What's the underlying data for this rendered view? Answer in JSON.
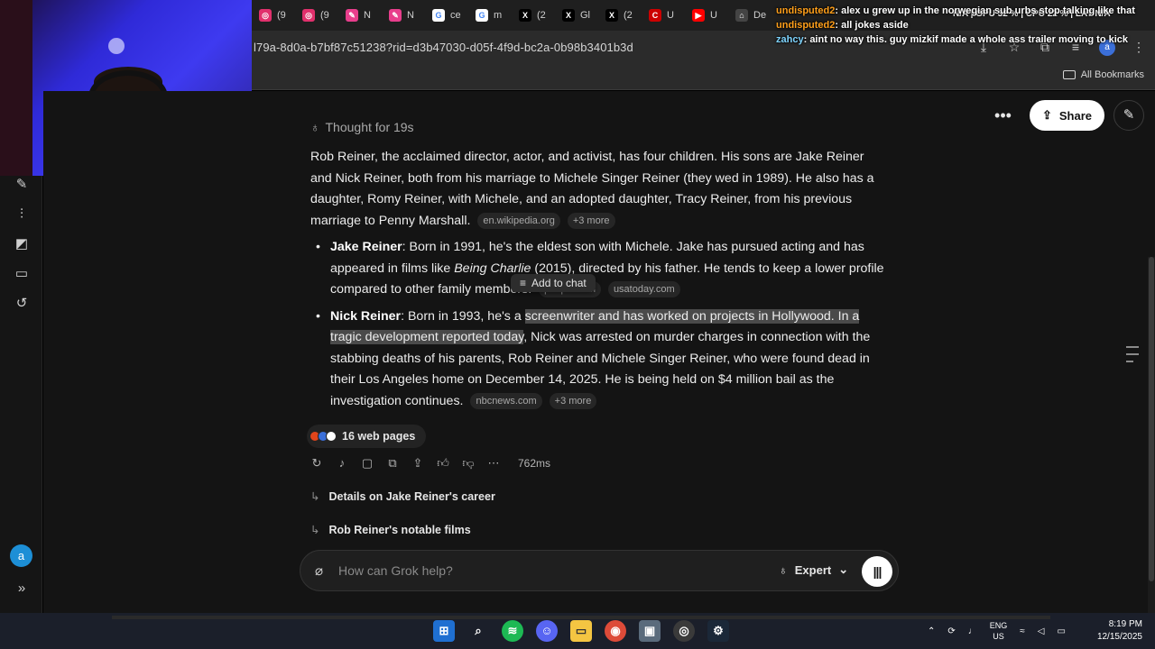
{
  "tabs": [
    {
      "label": "(9",
      "icon": "instagram-icon",
      "color": "#e1306c",
      "glyph": "◎"
    },
    {
      "label": "(9",
      "icon": "instagram-icon",
      "color": "#e1306c",
      "glyph": "◎"
    },
    {
      "label": "N",
      "icon": "pen-icon",
      "color": "#e83e8c",
      "glyph": "✎"
    },
    {
      "label": "N",
      "icon": "pen-icon",
      "color": "#e83e8c",
      "glyph": "✎"
    },
    {
      "label": "ce",
      "icon": "google-icon",
      "color": "#ffffff",
      "glyph": "G"
    },
    {
      "label": "m",
      "icon": "google-icon",
      "color": "#ffffff",
      "glyph": "G"
    },
    {
      "label": "(2",
      "icon": "x-icon",
      "color": "#000000",
      "glyph": "X"
    },
    {
      "label": "Gl",
      "icon": "x-icon",
      "color": "#000000",
      "glyph": "X"
    },
    {
      "label": "(2",
      "icon": "x-icon",
      "color": "#000000",
      "glyph": "X"
    },
    {
      "label": "U",
      "icon": "cnn-icon",
      "color": "#cc0000",
      "glyph": "C"
    },
    {
      "label": "U",
      "icon": "youtube-icon",
      "color": "#ff0000",
      "glyph": "▶"
    },
    {
      "label": "De",
      "icon": "bank-icon",
      "color": "#444444",
      "glyph": "⌂"
    }
  ],
  "address": {
    "url": "l79a-8d0a-b7bf87c51238?rid=d3b47030-d05f-4f9d-bc2a-0b98b3401b3d"
  },
  "bookmarks": {
    "all_label": "All Bookmarks"
  },
  "stream_chat": [
    {
      "user": "undisputed2",
      "text": "alex u grew up in the norwegian sub urbs stop talking like that",
      "user_color": "#ff9f1a"
    },
    {
      "user": "undisputed2",
      "text": "all jokes aside",
      "user_color": "#ff9f1a"
    },
    {
      "user": "zahcy",
      "text": "aint no way this. guy mizkif made a whole ass trailer moving to kick",
      "user_color": "#7fd5ff"
    }
  ],
  "stream_stats": {
    "text": "N/A | GPU 32 % | CPU 22 % | LAT N/A"
  },
  "header": {
    "share_label": "Share"
  },
  "response": {
    "thought": "Thought for 19s",
    "intro": "Rob Reiner, the acclaimed director, actor, and activist, has four children. His sons are Jake Reiner and Nick Reiner, both from his marriage to Michele Singer Reiner (they wed in 1989). He also has a daughter, Romy Reiner, with Michele, and an adopted daughter, Tracy Reiner, from his previous marriage to Penny Marshall.",
    "intro_source": "en.wikipedia.org",
    "intro_more": "+3 more",
    "jake": {
      "name": "Jake Reiner",
      "text_a": ": Born in 1991, he's the eldest son with Michele. Jake has pursued acting and has appeared in films like ",
      "film": "Being Charlie",
      "text_b": " (2015), directed by his father. He tends to keep a lower profile compared to other family members.",
      "source1": "people.com",
      "source2": "usatoday.com"
    },
    "nick": {
      "name": "Nick Reiner",
      "text_a": ": Born in 1993, he's a ",
      "highlight": "screenwriter and has worked on projects in Hollywood. In a tragic development reported today",
      "text_b": ", Nick was arrested on murder charges in connection with the stabbing deaths of his parents, Rob Reiner and Michele Singer Reiner, who were found dead in their Los Angeles home on December 14, 2025. He is being held on $4 million bail as the investigation continues.",
      "source": "nbcnews.com",
      "more": "+3 more"
    },
    "add_to_chat": "Add to chat",
    "web_pages": "16 web pages",
    "latency": "762ms"
  },
  "followups": [
    "Details on Jake Reiner's career",
    "Rob Reiner's notable films"
  ],
  "composer": {
    "placeholder": "How can Grok help?",
    "mode": "Expert"
  },
  "sidebar": {
    "avatar_letter": "a"
  },
  "taskbar": {
    "lang_top": "ENG",
    "lang_bottom": "US",
    "time": "8:19 PM",
    "date": "12/15/2025"
  }
}
